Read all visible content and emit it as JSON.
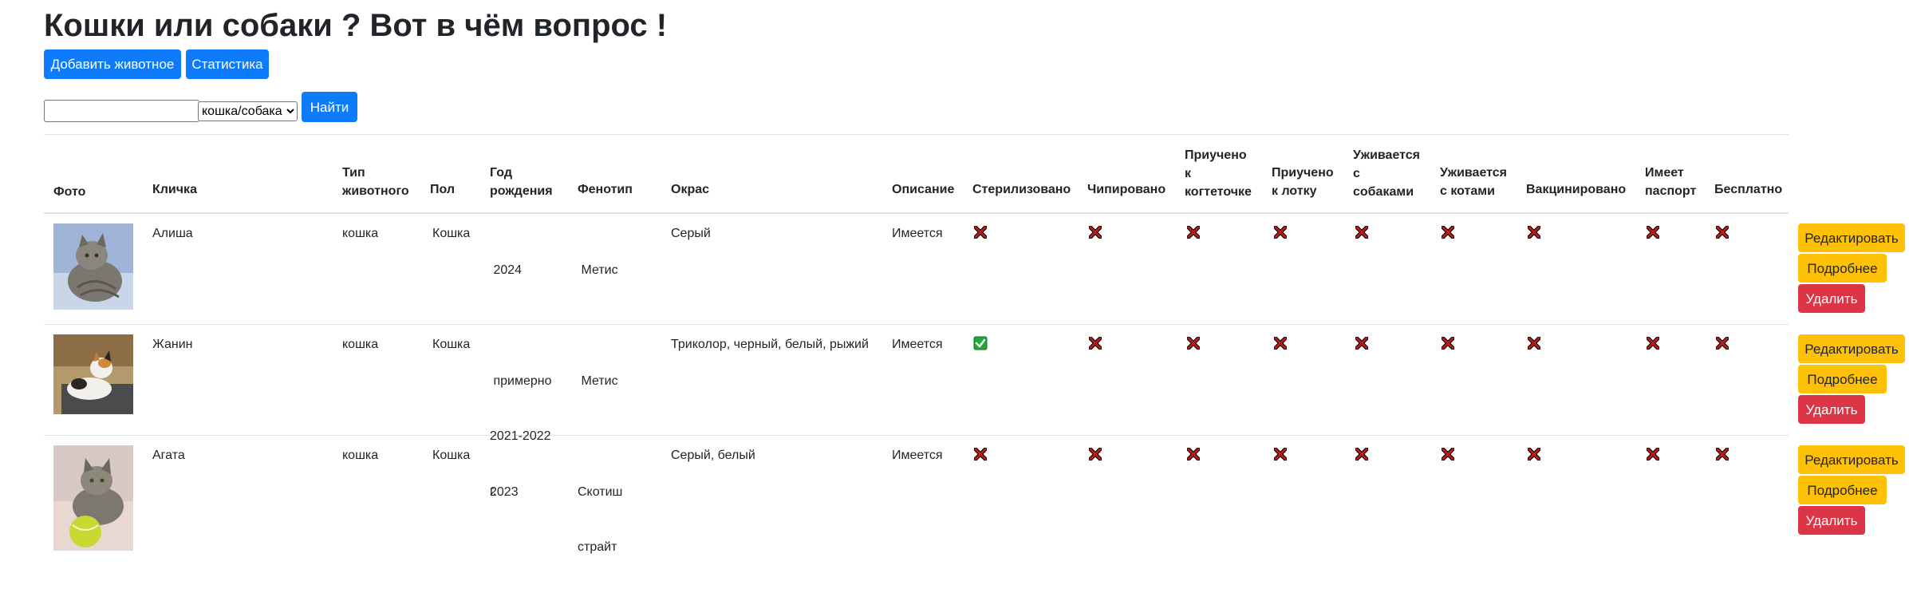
{
  "page": {
    "title": "Кошки или собаки ? Вот в чём вопрос !"
  },
  "toolbar": {
    "add_label": "Добавить животное",
    "stats_label": "Статистика"
  },
  "search": {
    "value": "",
    "placeholder": "",
    "type_selected": "кошка/собака",
    "find_label": "Найти"
  },
  "colors": {
    "primary": "#0d7bfa",
    "warning": "#ffc107",
    "danger": "#dc3545",
    "check_green": "#22a83a",
    "cross_red": "#b71c1c"
  },
  "table": {
    "headers": {
      "photo": "Фото",
      "name": "Кличка",
      "type_1": "Тип",
      "type_2": "животного",
      "sex": "Пол",
      "year_1": "Год",
      "year_2": "рождения",
      "phenotype": "Фенотип",
      "color": "Окрас",
      "description": "Описание",
      "sterilized": "Стерилизовано",
      "chipped": "Чипировано",
      "claw_1": "Приучено",
      "claw_2": "к",
      "claw_3": "когтеточке",
      "tray_1": "Приучено",
      "tray_2": "к лотку",
      "dogs_1": "Уживается",
      "dogs_2": "с",
      "dogs_3": "собаками",
      "cats_1": "Уживается",
      "cats_2": "с котами",
      "vaccinated": "Вакцинировано",
      "passport_1": "Имеет",
      "passport_2": "паспорт",
      "free": "Бесплатно"
    },
    "rows": [
      {
        "photo_icon": "cat-photo",
        "name": "Алиша",
        "type": "кошка",
        "sex": "Кошка",
        "year_1": " 2024",
        "year_2": "",
        "year_3": "",
        "phenotype_1": " Метис",
        "phenotype_2": "",
        "color": "Серый",
        "description": "Имеется",
        "flags": [
          "cross",
          "cross",
          "cross",
          "cross",
          "cross",
          "cross",
          "cross",
          "cross",
          "cross"
        ],
        "edit_label": "Редактировать",
        "details_label": "Подробнее",
        "delete_label": "Удалить"
      },
      {
        "photo_icon": "cat-photo",
        "name": "Жанин",
        "type": "кошка",
        "sex": "Кошка",
        "year_1": " примерно",
        "year_2": "2021-2022",
        "year_3": "г.",
        "phenotype_1": " Метис",
        "phenotype_2": "",
        "color": "Триколор, черный, белый, рыжий",
        "description": "Имеется",
        "flags": [
          "check",
          "cross",
          "cross",
          "cross",
          "cross",
          "cross",
          "cross",
          "cross",
          "cross"
        ],
        "edit_label": "Редактировать",
        "details_label": "Подробнее",
        "delete_label": "Удалить"
      },
      {
        "photo_icon": "cat-photo",
        "name": "Агата",
        "type": "кошка",
        "sex": "Кошка",
        "year_1": "2023",
        "year_2": "",
        "year_3": "",
        "phenotype_1": "Скотиш",
        "phenotype_2": "страйт",
        "color": "Серый, белый",
        "description": "Имеется",
        "flags": [
          "cross",
          "cross",
          "cross",
          "cross",
          "cross",
          "cross",
          "cross",
          "cross",
          "cross"
        ],
        "edit_label": "Редактировать",
        "details_label": "Подробнее",
        "delete_label": "Удалить"
      }
    ]
  }
}
